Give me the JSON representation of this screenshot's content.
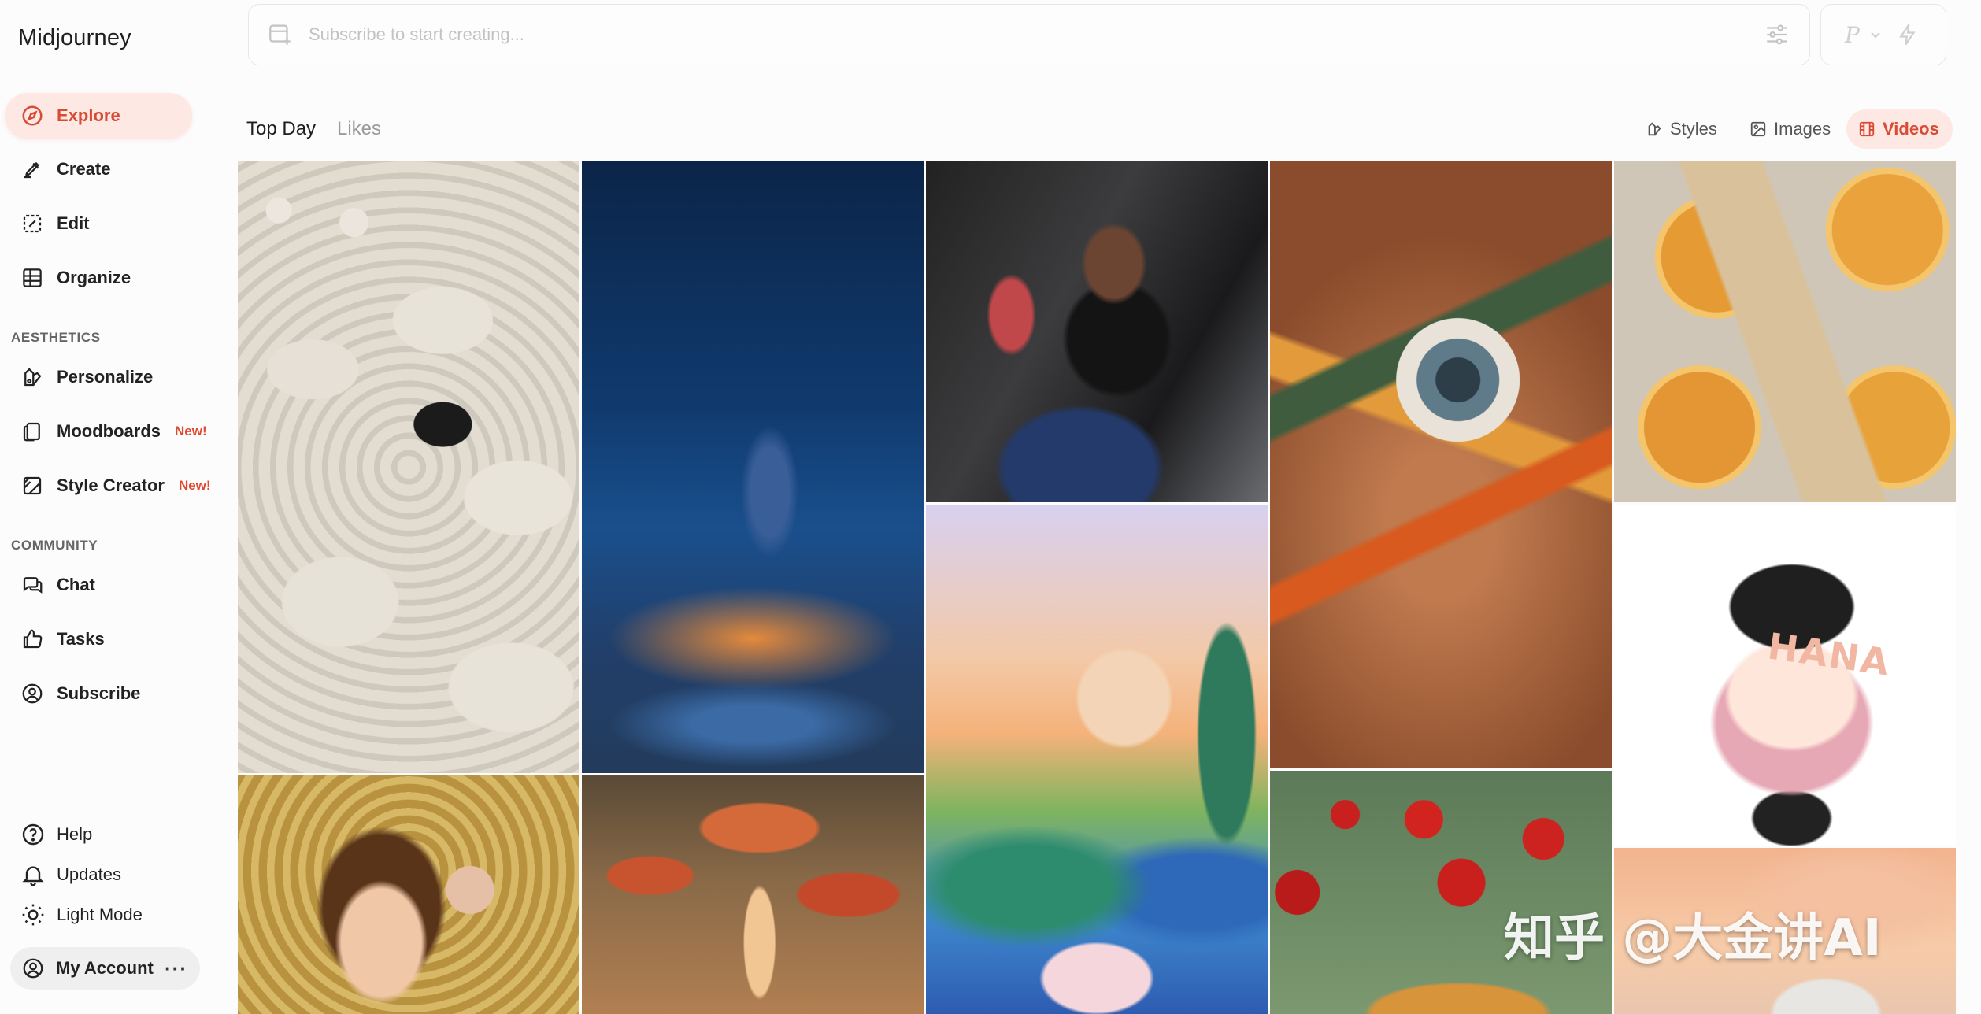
{
  "app": {
    "title": "Midjourney"
  },
  "sidebar": {
    "nav": [
      {
        "label": "Explore",
        "icon": "compass-icon",
        "active": true
      },
      {
        "label": "Create",
        "icon": "brush-icon"
      },
      {
        "label": "Edit",
        "icon": "edit-frame-icon"
      },
      {
        "label": "Organize",
        "icon": "grid-icon"
      }
    ],
    "aesthetics_title": "AESTHETICS",
    "aesthetics": [
      {
        "label": "Personalize",
        "icon": "palette-icon"
      },
      {
        "label": "Moodboards",
        "icon": "cards-icon",
        "badge": "New!"
      },
      {
        "label": "Style Creator",
        "icon": "style-creator-icon",
        "badge": "New!"
      }
    ],
    "community_title": "COMMUNITY",
    "community": [
      {
        "label": "Chat",
        "icon": "chat-icon"
      },
      {
        "label": "Tasks",
        "icon": "thumbs-up-icon"
      },
      {
        "label": "Subscribe",
        "icon": "user-circle-icon"
      }
    ],
    "bottom": [
      {
        "label": "Help",
        "icon": "help-icon"
      },
      {
        "label": "Updates",
        "icon": "bell-icon"
      },
      {
        "label": "Light Mode",
        "icon": "sun-icon"
      }
    ],
    "account": {
      "label": "My Account",
      "more": "···"
    }
  },
  "prompt": {
    "placeholder": "Subscribe to start creating...",
    "value": "",
    "mode_letter": "P"
  },
  "tabs": [
    {
      "label": "Top Day",
      "active": true
    },
    {
      "label": "Likes",
      "active": false
    }
  ],
  "filters": [
    {
      "label": "Styles",
      "icon": "styles-icon",
      "active": false
    },
    {
      "label": "Images",
      "icon": "image-icon",
      "active": false
    },
    {
      "label": "Videos",
      "icon": "film-icon",
      "active": true
    }
  ],
  "gallery": {
    "items": [
      {
        "name": "sheep-flock"
      },
      {
        "name": "starry-skater"
      },
      {
        "name": "car-portrait"
      },
      {
        "name": "painted-eye"
      },
      {
        "name": "orange-serum"
      },
      {
        "name": "hana-doll",
        "text": "HANA"
      },
      {
        "name": "pastel-villa"
      },
      {
        "name": "curly-portrait"
      },
      {
        "name": "glowing-mushrooms"
      },
      {
        "name": "hearts-croissant"
      },
      {
        "name": "sunset-child"
      }
    ]
  },
  "watermark": "知乎 @大金讲AI",
  "colors": {
    "accent": "#d84b35",
    "accent_bg": "#fde8e4",
    "badge": "#e0492f",
    "muted_text": "#9b9b9b"
  }
}
